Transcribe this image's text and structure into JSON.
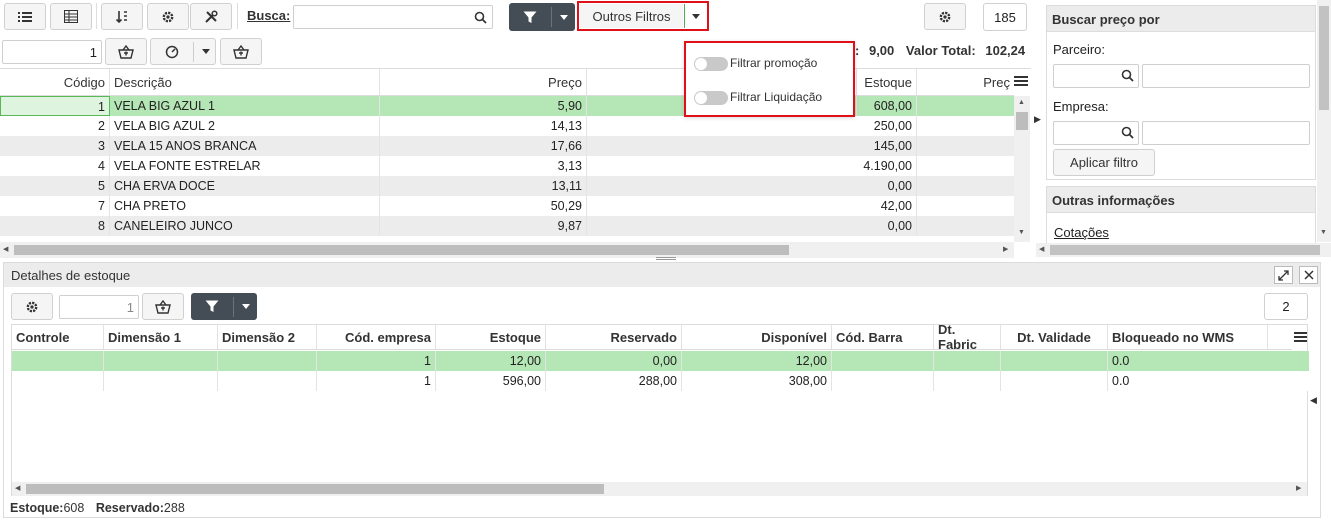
{
  "toolbar": {
    "search_label": "Busca:",
    "search_value": "",
    "other_filters_label": "Outros Filtros",
    "record_count": "185"
  },
  "secondary_toolbar": {
    "quantity": "1",
    "summary_prefix": ":",
    "summary_value1": "9,00",
    "total_label": "Valor Total:",
    "total_value": "102,24"
  },
  "filter_menu": {
    "items": [
      "Filtrar promoção",
      "Filtrar Liquidação"
    ]
  },
  "main_grid": {
    "columns": [
      "Código",
      "Descrição",
      "Preço",
      "Estoque",
      "Preç"
    ],
    "rows": [
      {
        "codigo": "1",
        "descricao": "VELA BIG AZUL 1",
        "preco": "5,90",
        "estoque": "608,00"
      },
      {
        "codigo": "2",
        "descricao": "VELA BIG AZUL 2",
        "preco": "14,13",
        "estoque": "250,00"
      },
      {
        "codigo": "3",
        "descricao": "VELA 15 ANOS BRANCA",
        "preco": "17,66",
        "estoque": "145,00"
      },
      {
        "codigo": "4",
        "descricao": "VELA FONTE ESTRELAR",
        "preco": "3,13",
        "estoque": "4.190,00"
      },
      {
        "codigo": "5",
        "descricao": "CHA ERVA DOCE",
        "preco": "13,11",
        "estoque": "0,00"
      },
      {
        "codigo": "7",
        "descricao": "CHA PRETO",
        "preco": "50,29",
        "estoque": "42,00"
      },
      {
        "codigo": "8",
        "descricao": "CANELEIRO JUNCO",
        "preco": "9,87",
        "estoque": "0,00"
      }
    ]
  },
  "right_panel": {
    "price_title": "Buscar preço por",
    "parceiro_label": "Parceiro:",
    "empresa_label": "Empresa:",
    "apply_filter": "Aplicar filtro",
    "other_info_title": "Outras informações",
    "cotacoes_link": "Cotações"
  },
  "stock_details": {
    "title": "Detalhes de estoque",
    "quantity": "1",
    "record_count": "2",
    "columns": [
      "Controle",
      "Dimensão 1",
      "Dimensão 2",
      "Cód. empresa",
      "Estoque",
      "Reservado",
      "Disponível",
      "Cód. Barra",
      "Dt. Fabric",
      "Dt. Validade",
      "Bloqueado no WMS"
    ],
    "rows": [
      {
        "controle": "",
        "dim1": "",
        "dim2": "",
        "empresa": "1",
        "estoque": "12,00",
        "reservado": "0,00",
        "disponivel": "12,00",
        "barra": "",
        "fabric": "",
        "validade": "",
        "wms": "0.0"
      },
      {
        "controle": "",
        "dim1": "",
        "dim2": "",
        "empresa": "1",
        "estoque": "596,00",
        "reservado": "288,00",
        "disponivel": "308,00",
        "barra": "",
        "fabric": "",
        "validade": "",
        "wms": "0.0"
      }
    ],
    "footer_estoque_label": "Estoque:",
    "footer_estoque_value": "608",
    "footer_reservado_label": "Reservado:",
    "footer_reservado_value": "288"
  },
  "colors": {
    "selected_row": "#b5e6b5",
    "alt_row": "#ececec",
    "highlight_border": "#e0101a",
    "dark_button": "#444c56",
    "accent_green": "#4caf50"
  }
}
